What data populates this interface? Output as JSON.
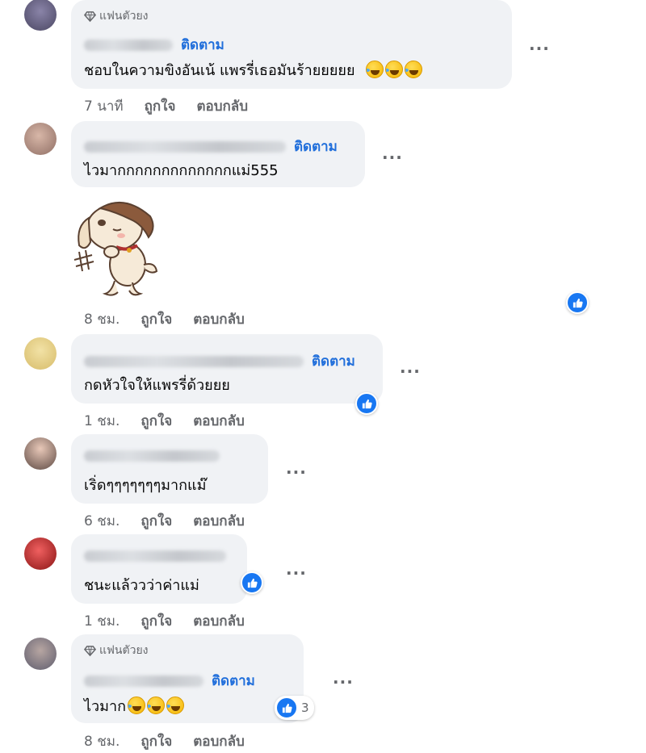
{
  "comments": [
    {
      "badge": "แฟนตัวยง",
      "follow_label": "ติดตาม",
      "text": "ชอบในความขิงอันเน้ แพรรี่เธอมันร้ายยยยย",
      "emojis": [
        "rolling-on-floor-laughing-emoji",
        "rolling-on-floor-laughing-emoji",
        "rolling-on-floor-laughing-emoji"
      ],
      "time": "7 นาที",
      "like_label": "ถูกใจ",
      "reply_label": "ตอบกลับ",
      "more_label": "..."
    },
    {
      "follow_label": "ติดตาม",
      "text": "ไวมากกกกกกกกกกกกกแม่555",
      "sticker": "dog-sticker",
      "time": "8 ชม.",
      "like_label": "ถูกใจ",
      "reply_label": "ตอบกลับ",
      "more_label": "...",
      "reaction": "like-icon"
    },
    {
      "follow_label": "ติดตาม",
      "text": "กดหัวใจให้แพรรี่ด้วยยย",
      "time": "1 ชม.",
      "like_label": "ถูกใจ",
      "reply_label": "ตอบกลับ",
      "more_label": "...",
      "reaction": "like-icon"
    },
    {
      "text": "เริ่ดๆๆๆๆๆๆๆมากแม๊",
      "time": "6 ชม.",
      "like_label": "ถูกใจ",
      "reply_label": "ตอบกลับ",
      "more_label": "..."
    },
    {
      "text": "ชนะแล้ววว่าค่าแม่",
      "time": "1 ชม.",
      "like_label": "ถูกใจ",
      "reply_label": "ตอบกลับ",
      "more_label": "...",
      "reaction": "like-icon"
    },
    {
      "badge": "แฟนตัวยง",
      "follow_label": "ติดตาม",
      "text": "ไวมาก",
      "emojis": [
        "rolling-on-floor-laughing-emoji",
        "rolling-on-floor-laughing-emoji",
        "rolling-on-floor-laughing-emoji"
      ],
      "time": "8 ชม.",
      "like_label": "ถูกใจ",
      "reply_label": "ตอบกลับ",
      "more_label": "...",
      "reaction": "like-icon",
      "reaction_count": "3"
    }
  ],
  "colors": {
    "bubble": "#f0f2f5",
    "follow": "#216fdb",
    "meta": "#65676b",
    "like_blue": "#1877f2"
  }
}
